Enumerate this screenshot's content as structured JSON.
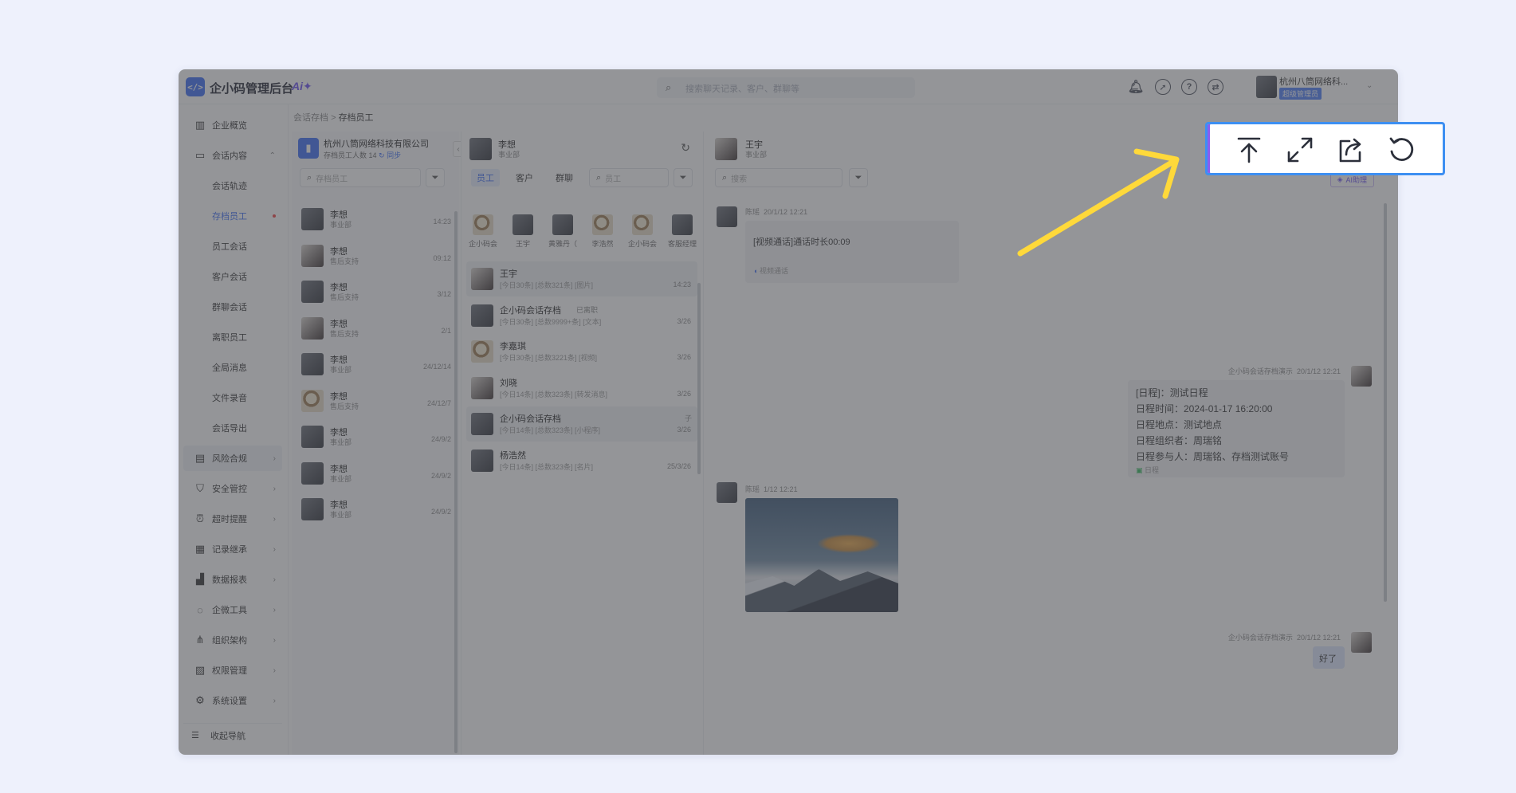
{
  "header": {
    "logo_text": "</>",
    "title": "企小码管理后台",
    "ai_label": "Ai✦",
    "search_placeholder": "搜索聊天记录、客户、群聊等",
    "user_name": "杭州八筒网络科...",
    "user_role": "超级管理员"
  },
  "sidebar": {
    "items": [
      {
        "label": "企业概览",
        "icon": "building-icon"
      },
      {
        "label": "会话内容",
        "icon": "folder-icon"
      },
      {
        "label": "会话轨迹"
      },
      {
        "label": "存档员工"
      },
      {
        "label": "员工会话"
      },
      {
        "label": "客户会话"
      },
      {
        "label": "群聊会话"
      },
      {
        "label": "离职员工"
      },
      {
        "label": "全局消息"
      },
      {
        "label": "文件录音"
      },
      {
        "label": "会话导出"
      },
      {
        "label": "风险合规",
        "icon": "book-icon"
      },
      {
        "label": "安全管控",
        "icon": "shield-icon"
      },
      {
        "label": "超时提醒",
        "icon": "alarm-icon"
      },
      {
        "label": "记录继承",
        "icon": "record-icon"
      },
      {
        "label": "数据报表",
        "icon": "chart-icon"
      },
      {
        "label": "企微工具",
        "icon": "chat-icon"
      },
      {
        "label": "组织架构",
        "icon": "org-icon"
      },
      {
        "label": "权限管理",
        "icon": "permission-icon"
      },
      {
        "label": "系统设置",
        "icon": "gear-icon"
      }
    ],
    "collapse_label": "收起导航"
  },
  "breadcrumb": {
    "parent": "会话存档",
    "sep": ">",
    "current": "存档员工"
  },
  "employees_panel": {
    "corp_name": "杭州八筒网络科技有限公司",
    "count_label": "存档员工人数 14",
    "sync_label": "同步",
    "search_placeholder": "存档员工",
    "rows": [
      {
        "name": "李想",
        "dept": "事业部",
        "time": "14:23"
      },
      {
        "name": "李想",
        "dept": "售后支持",
        "time": "09:12"
      },
      {
        "name": "李想",
        "dept": "售后支持",
        "time": "3/12"
      },
      {
        "name": "李想",
        "dept": "售后支持",
        "time": "2/1"
      },
      {
        "name": "李想",
        "dept": "事业部",
        "time": "24/12/14"
      },
      {
        "name": "李想",
        "dept": "售后支持",
        "time": "24/12/7"
      },
      {
        "name": "李想",
        "dept": "事业部",
        "time": "24/9/2"
      },
      {
        "name": "李想",
        "dept": "事业部",
        "time": "24/9/2"
      },
      {
        "name": "李想",
        "dept": "事业部",
        "time": "24/9/2"
      }
    ]
  },
  "conversations_panel": {
    "name": "李想",
    "dept": "事业部",
    "tabs": [
      "员工",
      "客户",
      "群聊"
    ],
    "search_placeholder": "员工",
    "contacts": [
      "企小码会",
      "王宇",
      "黄雅丹（",
      "李浩然",
      "企小码会",
      "客服经理"
    ],
    "rows": [
      {
        "name": "王宇",
        "tag": "",
        "desc": "[今日30条] [总数321条] [图片]",
        "time": "14:23"
      },
      {
        "name": "企小码会话存档",
        "tag": "已离职",
        "desc": "[今日30条] [总数9999+条] [文本]",
        "time": "3/26"
      },
      {
        "name": "李嘉琪",
        "tag": "",
        "desc": "[今日30条] [总数3221条] [视频]",
        "time": "3/26"
      },
      {
        "name": "刘晓",
        "tag": "",
        "desc": "[今日14条] [总数323条] [转发消息]",
        "time": "3/26"
      },
      {
        "name": "企小码会话存档",
        "tag": "子",
        "desc": "[今日14条] [总数323条] [小程序]",
        "time": "3/26"
      },
      {
        "name": "杨浩然",
        "tag": "",
        "desc": "[今日14条] [总数323条] [名片]",
        "time": "25/3/26"
      }
    ]
  },
  "chat_panel": {
    "name": "王宇",
    "dept": "事业部",
    "search_placeholder": "搜索",
    "ai_button": "AI助理",
    "messages": [
      {
        "sender": "陈瑶",
        "time": "20/1/12 12:21",
        "text": "[视频通话]通话时长00:09",
        "footer": "视频通话"
      },
      {
        "sender": "企小码会话存档演示",
        "time": "20/1/12 12:21",
        "lines": [
          "[日程]：测试日程",
          "日程时间：2024-01-17 16:20:00",
          "日程地点：测试地点",
          "日程组织者：周瑞铭",
          "日程参与人：周瑞铭、存档测试账号"
        ],
        "footer": "日程"
      },
      {
        "sender": "陈瑶",
        "time": "1/12 12:21"
      },
      {
        "sender": "企小码会话存档演示",
        "time": "20/1/12 12:21",
        "text": "好了"
      }
    ]
  },
  "toolbar": {
    "buttons": [
      "back-to-top",
      "fullscreen",
      "share",
      "refresh"
    ],
    "highlight_color": "#3d8ff2",
    "arrow_color": "#ffd93a"
  }
}
